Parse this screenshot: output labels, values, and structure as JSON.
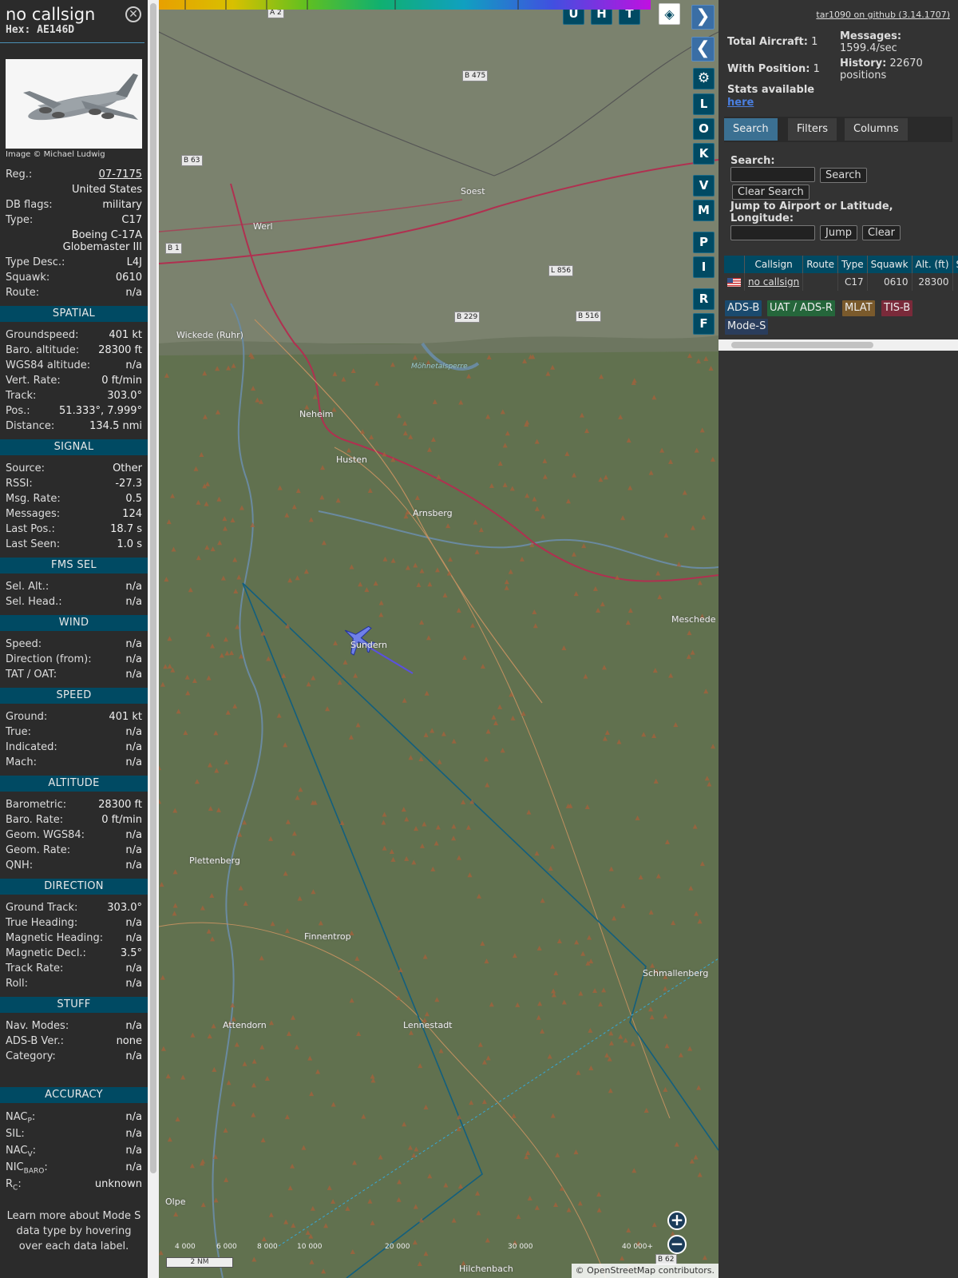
{
  "aircraft": {
    "callsign": "no callsign",
    "hex": "Hex: AE146D",
    "photo_credit": "Image © Michael Ludwig",
    "details": [
      {
        "k": "Reg.:",
        "v": "07-7175",
        "link": true
      },
      {
        "k": "",
        "v": "United States"
      },
      {
        "k": "DB flags:",
        "v": "military"
      },
      {
        "k": "Type:",
        "v": "C17"
      },
      {
        "k": "",
        "v": "Boeing C-17A Globemaster III",
        "multi": true
      },
      {
        "k": "Type Desc.:",
        "v": "L4J"
      },
      {
        "k": "Squawk:",
        "v": "0610"
      },
      {
        "k": "Route:",
        "v": "n/a"
      }
    ]
  },
  "sections": [
    {
      "title": "SPATIAL",
      "rows": [
        {
          "k": "Groundspeed:",
          "v": "401 kt"
        },
        {
          "k": "Baro. altitude:",
          "v": "28300 ft"
        },
        {
          "k": "WGS84 altitude:",
          "v": "n/a"
        },
        {
          "k": "Vert. Rate:",
          "v": "0 ft/min"
        },
        {
          "k": "Track:",
          "v": "303.0°"
        },
        {
          "k": "Pos.:",
          "v": "51.333°, 7.999°"
        },
        {
          "k": "Distance:",
          "v": "134.5 nmi"
        }
      ]
    },
    {
      "title": "SIGNAL",
      "rows": [
        {
          "k": "Source:",
          "v": "Other"
        },
        {
          "k": "RSSI:",
          "v": "-27.3"
        },
        {
          "k": "Msg. Rate:",
          "v": "0.5"
        },
        {
          "k": "Messages:",
          "v": "124"
        },
        {
          "k": "Last Pos.:",
          "v": "18.7 s"
        },
        {
          "k": "Last Seen:",
          "v": "1.0 s"
        }
      ]
    },
    {
      "title": "FMS SEL",
      "rows": [
        {
          "k": "Sel. Alt.:",
          "v": "n/a"
        },
        {
          "k": "Sel. Head.:",
          "v": "n/a"
        }
      ]
    },
    {
      "title": "WIND",
      "rows": [
        {
          "k": "Speed:",
          "v": "n/a"
        },
        {
          "k": "Direction (from):",
          "v": "n/a"
        },
        {
          "k": "TAT / OAT:",
          "v": "n/a"
        }
      ]
    },
    {
      "title": "SPEED",
      "rows": [
        {
          "k": "Ground:",
          "v": "401 kt"
        },
        {
          "k": "True:",
          "v": "n/a"
        },
        {
          "k": "Indicated:",
          "v": "n/a"
        },
        {
          "k": "Mach:",
          "v": "n/a"
        }
      ]
    },
    {
      "title": "ALTITUDE",
      "rows": [
        {
          "k": "Barometric:",
          "v": "28300 ft"
        },
        {
          "k": "Baro. Rate:",
          "v": "0 ft/min"
        },
        {
          "k": "Geom. WGS84:",
          "v": "n/a"
        },
        {
          "k": "Geom. Rate:",
          "v": "n/a"
        },
        {
          "k": "QNH:",
          "v": "n/a"
        }
      ]
    },
    {
      "title": "DIRECTION",
      "rows": [
        {
          "k": "Ground Track:",
          "v": "303.0°"
        },
        {
          "k": "True Heading:",
          "v": "n/a"
        },
        {
          "k": "Magnetic Heading:",
          "v": "n/a"
        },
        {
          "k": "Magnetic Decl.:",
          "v": "3.5°"
        },
        {
          "k": "Track Rate:",
          "v": "n/a"
        },
        {
          "k": "Roll:",
          "v": "n/a"
        }
      ]
    },
    {
      "title": "STUFF",
      "rows": [
        {
          "k": "Nav. Modes:",
          "v": "n/a"
        },
        {
          "k": "ADS-B Ver.:",
          "v": "none"
        },
        {
          "k": "Category:",
          "v": "n/a"
        }
      ]
    }
  ],
  "accuracy": {
    "title": "ACCURACY",
    "rows": [
      {
        "k": "NAC",
        "sub": "P",
        "v": "n/a"
      },
      {
        "k": "SIL:",
        "sub": "",
        "v": "n/a"
      },
      {
        "k": "NAC",
        "sub": "V",
        "v": "n/a"
      },
      {
        "k": "NIC",
        "sub": "BARO",
        "v": "n/a"
      },
      {
        "k": "R",
        "sub": "C",
        "v": "unknown"
      }
    ],
    "learn_more": "Learn more about Mode S data type by hovering over each data label."
  },
  "map": {
    "top_buttons": [
      "U",
      "H",
      "T"
    ],
    "side_buttons": [
      "L",
      "O",
      "K",
      "V",
      "M",
      "P",
      "I",
      "R",
      "F"
    ],
    "places": [
      "Soest",
      "Werl",
      "Wickede (Ruhr)",
      "Neheim",
      "Husten",
      "Arnsberg",
      "Meschede",
      "Sundern",
      "Plettenberg",
      "Finnentrop",
      "Schmallenberg",
      "Attendorn",
      "Lennestadt",
      "Olpe",
      "Hilchenbach",
      "Möhnetalsperre"
    ],
    "roads": [
      "A 2",
      "B 475",
      "B 63",
      "B 1",
      "L 856",
      "B 229",
      "B 516",
      "B 62"
    ],
    "altitude_scale": [
      "4 000",
      "6 000",
      "8 000",
      "10 000",
      "20 000",
      "30 000",
      "40 000+"
    ],
    "scale_label": "2 NM",
    "attribution": "© OpenStreetMap contributors."
  },
  "panel": {
    "github_link": "tar1090 on github (3.14.1707)",
    "total_aircraft_label": "Total Aircraft:",
    "total_aircraft": "1",
    "with_position_label": "With Position:",
    "with_position": "1",
    "stats_label": "Stats available",
    "stats_link": "here",
    "messages_label": "Messages:",
    "messages": "1599.4/sec",
    "history_label": "History:",
    "history": "22670 positions",
    "tabs": [
      "Search",
      "Filters",
      "Columns"
    ],
    "search_label": "Search:",
    "search_button": "Search",
    "clear_search_button": "Clear Search",
    "jump_label": "Jump to Airport or Latitude, Longitude:",
    "jump_button": "Jump",
    "clear_button": "Clear",
    "table_headers": [
      "",
      "Callsign",
      "Route",
      "Type",
      "Squawk",
      "Alt. (ft)",
      "S"
    ],
    "table_rows": [
      [
        "",
        "no callsign",
        "",
        "C17",
        "0610",
        "28300",
        ""
      ]
    ],
    "legend": [
      {
        "label": "ADS-B",
        "color": "#1a4a6e"
      },
      {
        "label": "UAT / ADS-R",
        "color": "#25663b"
      },
      {
        "label": "MLAT",
        "color": "#7a5a2c"
      },
      {
        "label": "TIS-B",
        "color": "#7a2a3a"
      },
      {
        "label": "Mode-S",
        "color": "#2a3d5c"
      }
    ]
  }
}
